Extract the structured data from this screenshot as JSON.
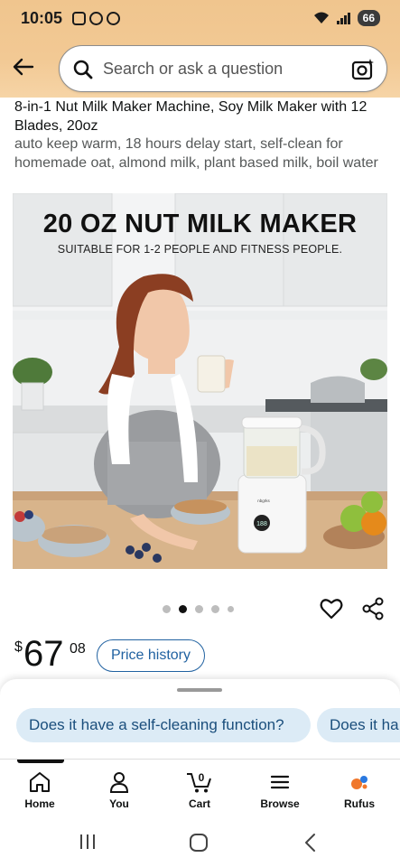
{
  "status_bar": {
    "time": "10:05",
    "battery": "66"
  },
  "search": {
    "placeholder": "Search or ask a question"
  },
  "product": {
    "title": "8-in-1 Nut Milk Maker Machine, Soy Milk Maker with 12 Blades, 20oz",
    "subtitle": "auto keep warm, 18 hours delay start, self-clean for homemade oat, almond milk, plant based milk, boil water",
    "image": {
      "headline": "20 OZ NUT MILK MAKER",
      "subheadline": "SUITABLE FOR 1-2 PEOPLE AND FITNESS PEOPLE.",
      "device_brand": "nbgrks",
      "device_display": "188"
    },
    "carousel": {
      "count": 5,
      "active_index": 1
    },
    "price": {
      "currency": "$",
      "whole": "67",
      "fraction": "08"
    },
    "price_history_label": "Price history"
  },
  "rufus_suggestions": [
    "Does it have a self-cleaning function?",
    "Does it ha"
  ],
  "bottom_nav": [
    {
      "label": "Home",
      "icon": "home-icon"
    },
    {
      "label": "You",
      "icon": "user-icon"
    },
    {
      "label": "Cart",
      "icon": "cart-icon",
      "badge": "0"
    },
    {
      "label": "Browse",
      "icon": "menu-icon"
    },
    {
      "label": "Rufus",
      "icon": "rufus-icon"
    }
  ],
  "colors": {
    "header": "#f2c994",
    "link": "#2162a1",
    "chip_bg": "#dcebf6"
  }
}
